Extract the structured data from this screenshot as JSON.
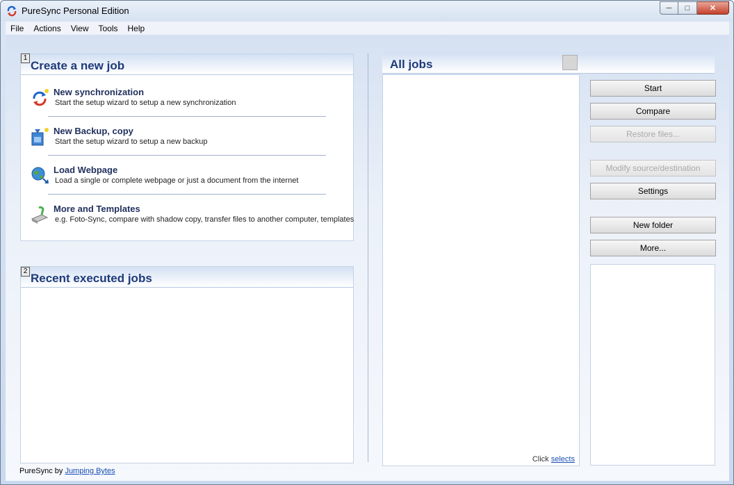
{
  "window": {
    "title": "PureSync Personal Edition"
  },
  "menu": [
    "File",
    "Actions",
    "View",
    "Tools",
    "Help"
  ],
  "create_panel": {
    "badge": "1",
    "title": "Create a new job",
    "entries": [
      {
        "title": "New synchronization",
        "desc": "Start the setup wizard to setup a new synchronization",
        "icon": "sync-icon"
      },
      {
        "title": "New Backup, copy",
        "desc": "Start the setup wizard to setup a new backup",
        "icon": "backup-icon"
      },
      {
        "title": "Load Webpage",
        "desc": "Load a single or complete webpage or just a document from the internet",
        "icon": "globe-icon"
      },
      {
        "title": "More and Templates",
        "desc": "e.g. Foto-Sync, compare with shadow copy, transfer files to another computer, templates",
        "icon": "templates-icon"
      }
    ]
  },
  "recent_panel": {
    "badge": "2",
    "title": "Recent executed jobs"
  },
  "all_jobs": {
    "title": "All jobs",
    "click_prefix": "Click",
    "click_link": "selects"
  },
  "buttons": {
    "start": "Start",
    "compare": "Compare",
    "restore": "Restore files...",
    "modify": "Modify source/destination",
    "settings": "Settings",
    "new_folder": "New folder",
    "more": "More..."
  },
  "footer": {
    "prefix": "PureSync by",
    "link": "Jumping Bytes"
  },
  "colors": {
    "header_text": "#1f3a7a",
    "link": "#1a4fb4"
  }
}
